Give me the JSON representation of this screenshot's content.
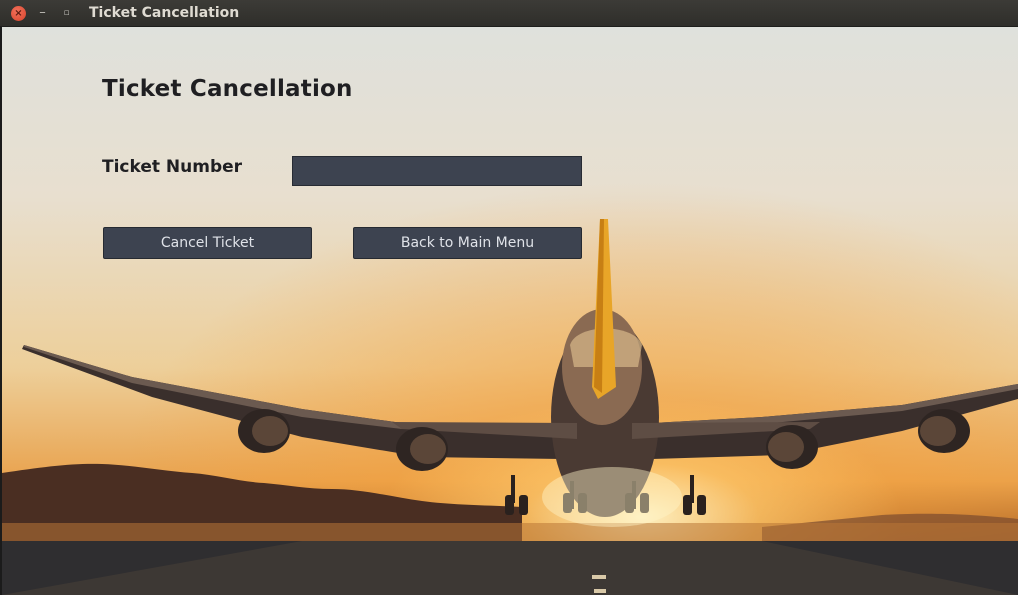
{
  "window": {
    "title": "Ticket Cancellation",
    "controls": {
      "close_glyph": "×",
      "minimize_glyph": "–",
      "maximize_glyph": "▫"
    }
  },
  "form": {
    "heading": "Ticket Cancellation",
    "ticket_number_label": "Ticket Number",
    "ticket_number_value": "",
    "cancel_button_label": "Cancel Ticket",
    "back_button_label": "Back to Main Menu"
  },
  "colors": {
    "titlebar": "#3c3b37",
    "close_button": "#d8442c",
    "field_background": "#3d4350",
    "button_background": "#3d4350",
    "heading_text": "#1f1f22"
  },
  "icons": {
    "close": "close-icon",
    "minimize": "minimize-icon",
    "maximize": "maximize-icon"
  },
  "background": {
    "description_tag": "airplane-sunset-runway"
  }
}
